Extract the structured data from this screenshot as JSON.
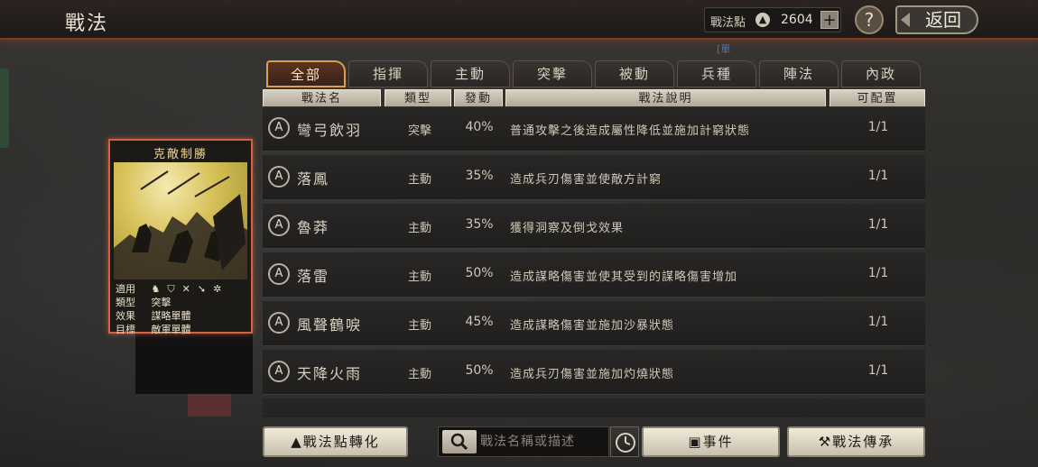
{
  "header": {
    "title": "戰法",
    "points_label": "戰法點",
    "points_value": "2604",
    "plus": "+",
    "help": "?",
    "back_label": "返回",
    "tiny_mark": "[單"
  },
  "card": {
    "title": "克敵制勝",
    "rows": [
      {
        "key": "適用",
        "value": ""
      },
      {
        "key": "類型",
        "value": "突擊"
      },
      {
        "key": "效果",
        "value": "謀略單體"
      },
      {
        "key": "目標",
        "value": "敵軍單體"
      }
    ],
    "apply_icons": [
      "cavalry-icon",
      "shield-icon",
      "crossbow-icon",
      "spear-icon",
      "wheel-icon"
    ]
  },
  "tabs": [
    {
      "label": "全部",
      "active": true
    },
    {
      "label": "指揮",
      "active": false
    },
    {
      "label": "主動",
      "active": false
    },
    {
      "label": "突擊",
      "active": false
    },
    {
      "label": "被動",
      "active": false
    },
    {
      "label": "兵種",
      "active": false
    },
    {
      "label": "陣法",
      "active": false
    },
    {
      "label": "內政",
      "active": false
    }
  ],
  "columns": {
    "name": "戰法名",
    "type": "類型",
    "rate": "發動",
    "desc": "戰法說明",
    "cfg": "可配置"
  },
  "rows": [
    {
      "grade": "A",
      "name": "彎弓飲羽",
      "type": "突擊",
      "rate": "40%",
      "desc": "普通攻擊之後造成屬性降低並施加計窮狀態",
      "cfg": "1/1"
    },
    {
      "grade": "A",
      "name": "落鳳",
      "type": "主動",
      "rate": "35%",
      "desc": "造成兵刃傷害並使敵方計窮",
      "cfg": "1/1"
    },
    {
      "grade": "A",
      "name": "魯莽",
      "type": "主動",
      "rate": "35%",
      "desc": "獲得洞察及倒戈效果",
      "cfg": "1/1"
    },
    {
      "grade": "A",
      "name": "落雷",
      "type": "主動",
      "rate": "50%",
      "desc": "造成謀略傷害並使其受到的謀略傷害增加",
      "cfg": "1/1"
    },
    {
      "grade": "A",
      "name": "風聲鶴唳",
      "type": "主動",
      "rate": "45%",
      "desc": "造成謀略傷害並施加沙暴狀態",
      "cfg": "1/1"
    },
    {
      "grade": "A",
      "name": "天降火雨",
      "type": "主動",
      "rate": "50%",
      "desc": "造成兵刃傷害並施加灼燒狀態",
      "cfg": "1/1"
    }
  ],
  "bottom": {
    "convert_label": "戰法點轉化",
    "search_placeholder": "戰法名稱或描述",
    "event_label": "事件",
    "inherit_label": "戰法傳承"
  }
}
